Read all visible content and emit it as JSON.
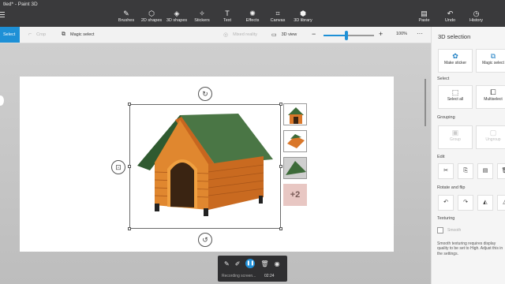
{
  "window": {
    "title": "tled* - Paint 3D"
  },
  "toolbar": {
    "tools": [
      {
        "label": "Brushes",
        "icon": "brush-icon",
        "glyph": "✎"
      },
      {
        "label": "2D shapes",
        "icon": "2d-shapes-icon",
        "glyph": "⬡"
      },
      {
        "label": "3D shapes",
        "icon": "3d-shapes-icon",
        "glyph": "◈"
      },
      {
        "label": "Stickers",
        "icon": "stickers-icon",
        "glyph": "✧"
      },
      {
        "label": "Text",
        "icon": "text-icon",
        "glyph": "T"
      },
      {
        "label": "Effects",
        "icon": "effects-icon",
        "glyph": "✺"
      },
      {
        "label": "Canvas",
        "icon": "canvas-icon",
        "glyph": "⌗"
      },
      {
        "label": "3D library",
        "icon": "3d-library-icon",
        "glyph": "⬢"
      }
    ],
    "right_tools": [
      {
        "label": "Paste",
        "icon": "paste-icon",
        "glyph": "▤"
      },
      {
        "label": "Undo",
        "icon": "undo-icon",
        "glyph": "↶"
      },
      {
        "label": "History",
        "icon": "history-icon",
        "glyph": "◷"
      }
    ]
  },
  "subbar": {
    "select": "Select",
    "crop": "Crop",
    "magic_select": "Magic select",
    "mixed_reality": "Mixed reality",
    "view_3d": "3D view",
    "zoom": "100%",
    "zoom_level": 0.45,
    "more": "···"
  },
  "recording": {
    "text": "Recording screen...",
    "time": "02:24"
  },
  "panel": {
    "title": "3D selection",
    "make_sticker": "Make sticker",
    "magic_select": "Magic select",
    "select_label": "Select",
    "select_all": "Select all",
    "multiselect": "Multiselect",
    "grouping_label": "Grouping",
    "group": "Group",
    "ungroup": "Ungroup",
    "edit_label": "Edit",
    "rotate_label": "Rotate and flip",
    "texturing_label": "Texturing",
    "smooth": "Smooth",
    "note": "Smooth texturing requires display quality to be set to High. Adjust this in the settings."
  },
  "thumbs": {
    "more_count": "+2"
  },
  "colors": {
    "accent": "#1e90d6",
    "roof": "#3e6b3a",
    "wood": "#d9772a"
  }
}
